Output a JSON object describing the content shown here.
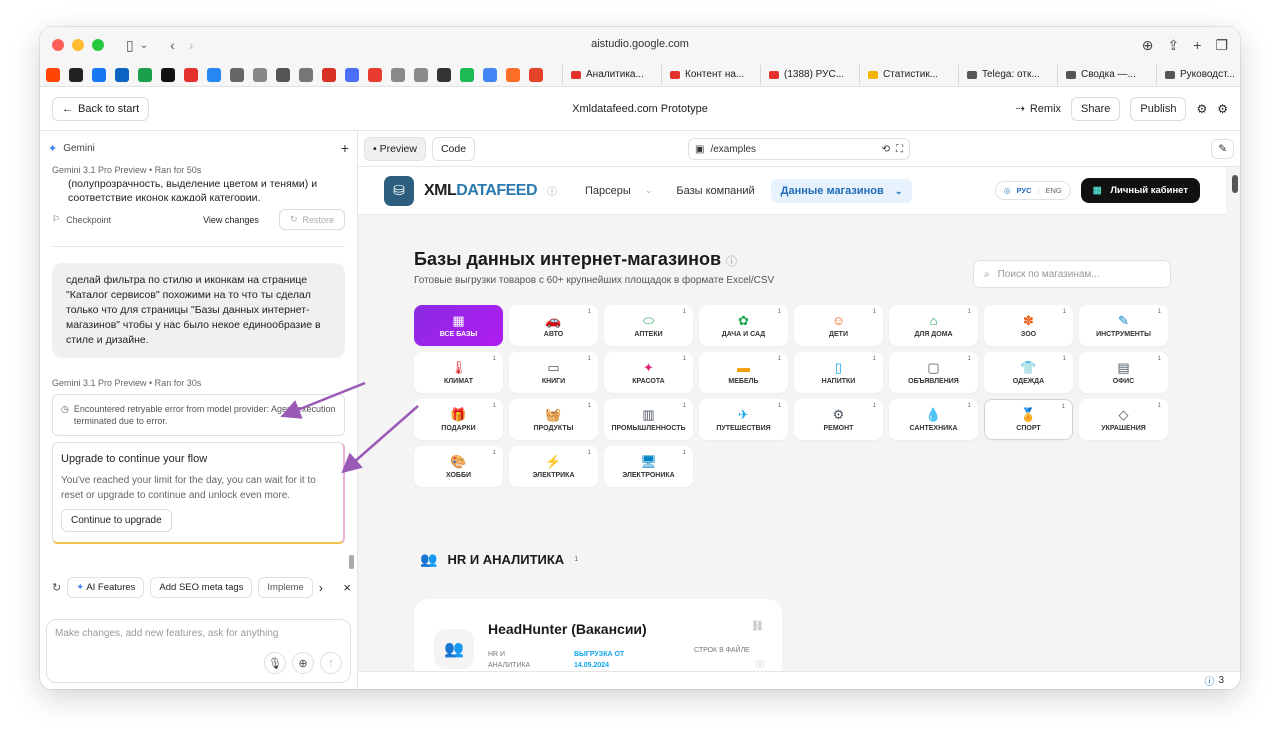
{
  "browser": {
    "url": "aistudio.google.com",
    "tabs": [
      {
        "label": "Аналитика...",
        "color": "#e3312d"
      },
      {
        "label": "Контент на...",
        "color": "#e3312d"
      },
      {
        "label": "(1388) РУС...",
        "color": "#e3312d"
      },
      {
        "label": "Статистик...",
        "color": "#f2b400"
      },
      {
        "label": "Telega: отк...",
        "color": "#555555"
      },
      {
        "label": "Сводка —...",
        "color": "#555555"
      },
      {
        "label": "Руководст...",
        "color": "#555555"
      }
    ],
    "bookmark_colors": [
      "#ff4500",
      "#222222",
      "#1877f2",
      "#0a66c2",
      "#1a9f4a",
      "#111111",
      "#e3312d",
      "#2787f5",
      "#666666",
      "#888888",
      "#555555",
      "#777777",
      "#d93025",
      "#4c6ef5",
      "#e63b2e",
      "#8a8a8a",
      "#8a8a8a",
      "#333333",
      "#1db954",
      "#4285f4",
      "#fc6d26",
      "#e24329"
    ]
  },
  "app": {
    "back_label": "Back to start",
    "title": "Xmldatafeed.com Prototype",
    "remix": "Remix",
    "share": "Share",
    "publish": "Publish"
  },
  "chat": {
    "assistant": "Gemini",
    "run1_meta": "Gemini 3.1 Pro Preview  •  Ran for 50s",
    "run1_text": "(полупрозрачность, выделение цветом и тенями) и соответствие иконок каждой категории.",
    "checkpoint": "Checkpoint",
    "view_changes": "View changes",
    "restore": "Restore",
    "user_msg": "сделай фильтра по стилю и иконкам на странице \"Каталог сервисов\" похожими на то что ты сделал только что для страницы \"Базы данных интернет-магазинов\" чтобы у нас было некое единообразие в стиле и дизайне.",
    "run2_meta": "Gemini 3.1 Pro Preview  •  Ran for 30s",
    "error_text": "Encountered retryable error from model provider: Agent execution terminated due to error.",
    "upgrade_title": "Upgrade to continue your flow",
    "upgrade_text": "You've reached your limit for the day, you can wait for it to reset or upgrade to continue and unlock even more.",
    "upgrade_btn": "Continue to upgrade",
    "chips": [
      "AI Features",
      "Add SEO meta tags",
      "Impleme"
    ],
    "input_placeholder": "Make changes, add new features, ask for anything"
  },
  "preview": {
    "tab_preview": "Preview",
    "tab_code": "Code",
    "path": "/examples",
    "footer_count": "3"
  },
  "site": {
    "brand_a": "XML",
    "brand_b": "DATAFEED",
    "nav": [
      "Парсеры",
      "Базы компаний"
    ],
    "nav_active": "Данные магазинов",
    "lang_ru": "РУС",
    "lang_en": "ENG",
    "cabinet": "Личный кабинет",
    "heading": "Базы данных интернет-магазинов",
    "subheading": "Готовые выгрузки товаров с 60+ крупнейших площадок в формате Excel/CSV",
    "search_placeholder": "Поиск по магазинам...",
    "categories": [
      {
        "label": "ВСЕ БАЗЫ",
        "icon": "▦",
        "color": "#ffffff",
        "count": "",
        "state": "active"
      },
      {
        "label": "АВТО",
        "icon": "🚗",
        "color": "#ea580c",
        "count": "1",
        "state": ""
      },
      {
        "label": "АПТЕКИ",
        "icon": "⬭",
        "color": "#16a34a",
        "count": "1",
        "state": ""
      },
      {
        "label": "ДАЧА И САД",
        "icon": "✿",
        "color": "#16a34a",
        "count": "1",
        "state": ""
      },
      {
        "label": "ДЕТИ",
        "icon": "☺",
        "color": "#ea580c",
        "count": "1",
        "state": ""
      },
      {
        "label": "ДЛЯ ДОМА",
        "icon": "⌂",
        "color": "#16a34a",
        "count": "1",
        "state": ""
      },
      {
        "label": "ЗОО",
        "icon": "✽",
        "color": "#ea580c",
        "count": "1",
        "state": ""
      },
      {
        "label": "ИНСТРУМЕНТЫ",
        "icon": "✎",
        "color": "#0284c7",
        "count": "1",
        "state": ""
      },
      {
        "label": "КЛИМАТ",
        "icon": "🌡",
        "color": "#dc2626",
        "count": "1",
        "state": ""
      },
      {
        "label": "КНИГИ",
        "icon": "▭",
        "color": "#4b5563",
        "count": "1",
        "state": ""
      },
      {
        "label": "КРАСОТА",
        "icon": "✦",
        "color": "#db2777",
        "count": "1",
        "state": ""
      },
      {
        "label": "МЕБЕЛЬ",
        "icon": "▬",
        "color": "#f59e0b",
        "count": "1",
        "state": ""
      },
      {
        "label": "НАПИТКИ",
        "icon": "▯",
        "color": "#0ea5e9",
        "count": "1",
        "state": ""
      },
      {
        "label": "ОБЪЯВЛЕНИЯ",
        "icon": "▢",
        "color": "#4b5563",
        "count": "1",
        "state": ""
      },
      {
        "label": "ОДЕЖДА",
        "icon": "👕",
        "color": "#9333ea",
        "count": "1",
        "state": ""
      },
      {
        "label": "ОФИС",
        "icon": "▤",
        "color": "#4b5563",
        "count": "1",
        "state": ""
      },
      {
        "label": "ПОДАРКИ",
        "icon": "🎁",
        "color": "#dc2626",
        "count": "1",
        "state": ""
      },
      {
        "label": "ПРОДУКТЫ",
        "icon": "🧺",
        "color": "#16a34a",
        "count": "1",
        "state": ""
      },
      {
        "label": "ПРОМЫШЛЕННОСТЬ",
        "icon": "▥",
        "color": "#4b5563",
        "count": "1",
        "state": ""
      },
      {
        "label": "ПУТЕШЕСТВИЯ",
        "icon": "✈",
        "color": "#0ea5e9",
        "count": "1",
        "state": ""
      },
      {
        "label": "РЕМОНТ",
        "icon": "⚙",
        "color": "#4b5563",
        "count": "1",
        "state": ""
      },
      {
        "label": "САНТЕХНИКА",
        "icon": "💧",
        "color": "#0284c7",
        "count": "1",
        "state": ""
      },
      {
        "label": "СПОРТ",
        "icon": "🏅",
        "color": "#ea580c",
        "count": "1",
        "state": "sel"
      },
      {
        "label": "УКРАШЕНИЯ",
        "icon": "◇",
        "color": "#4b5563",
        "count": "1",
        "state": ""
      },
      {
        "label": "ХОББИ",
        "icon": "🎨",
        "color": "#db2777",
        "count": "1",
        "state": ""
      },
      {
        "label": "ЭЛЕКТРИКА",
        "icon": "⚡",
        "color": "#eab308",
        "count": "1",
        "state": ""
      },
      {
        "label": "ЭЛЕКТРОНИКА",
        "icon": "🖥",
        "color": "#0284c7",
        "count": "1",
        "state": ""
      }
    ],
    "section_title": "HR И АНАЛИТИКА",
    "section_count": "1",
    "card": {
      "title": "HeadHunter (Вакансии)",
      "category": "HR И АНАЛИТИКА",
      "export_label": "ВЫГРУЗКА ОТ 14.05.2024",
      "rows_label": "СТРОК В ФАЙЛЕ"
    }
  }
}
